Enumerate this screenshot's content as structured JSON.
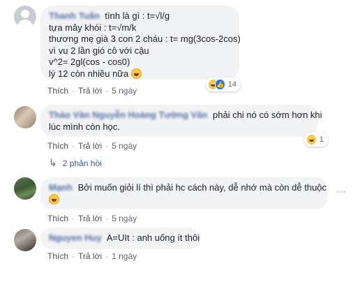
{
  "comments": [
    {
      "author": "Thanh Tuấn",
      "lines": [
        "tình là gì : t=√l/g",
        "tựa mây khói : t=√m/k",
        "thương mẹ già 3 con 2 cháu : t= mg(3cos-2cos)",
        "vì vu 2 lần gió cô với cậu",
        "v^2= 2gl(cos - cos0)",
        "lý 12 còn nhiều nữa"
      ],
      "actions": {
        "like": "Thích",
        "reply": "Trả lời",
        "time": "5 ngày"
      },
      "reactions": {
        "icons": [
          "haha-icon",
          "like-icon"
        ],
        "count": "14"
      }
    },
    {
      "author": "Thảo Vân Nguyễn Hoàng Tường Vân",
      "lines": [
        "phải chi nó có sớm hơn khi",
        "lúc mình còn học."
      ],
      "actions": {
        "like": "Thích",
        "reply": "Trả lời",
        "time": "5 ngày"
      },
      "reactions": {
        "icons": [
          "haha-icon"
        ],
        "count": "1"
      },
      "replies_label": "2 phản hồi"
    },
    {
      "author": "Mạnh",
      "lines": [
        "Bởi muốn giỏi lí thì phải hc cách này, dễ nhớ mà còn dễ thuộc",
        ""
      ],
      "actions": {
        "like": "Thích",
        "reply": "Trả lời",
        "time": "5 ngày"
      }
    },
    {
      "author": "Nguyen Huy",
      "lines": [
        "A=UIt : anh uống ít thôi"
      ],
      "actions": {
        "like": "Thích",
        "reply": "Trả lời",
        "time": "1 ngày"
      }
    }
  ],
  "more_icon": "more-horizontal-icon",
  "colors": {
    "link": "#385898",
    "bubble": "#f2f3f5",
    "meta": "#606770",
    "like_blue": "#1877f2",
    "haha_yellow": "#f7c844"
  }
}
